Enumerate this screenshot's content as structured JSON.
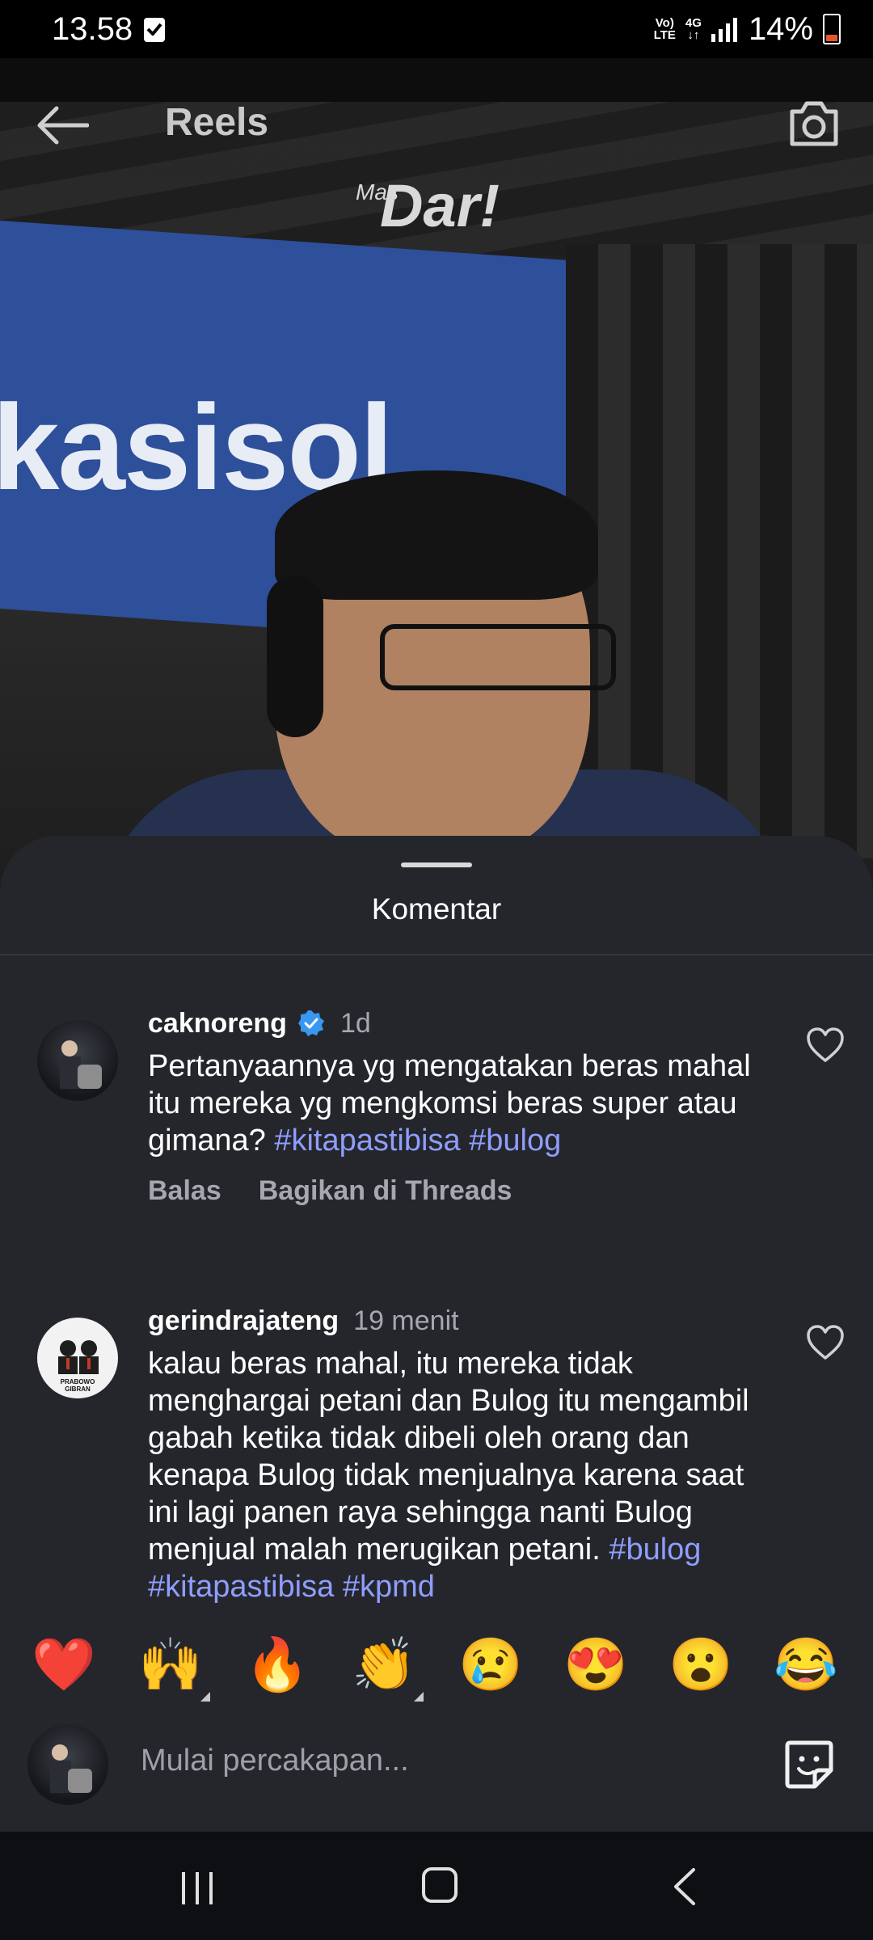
{
  "status_bar": {
    "time": "13.58",
    "network_top": "Vo)",
    "network_bottom": "LTE",
    "network_type": "4G",
    "battery": "14%"
  },
  "video": {
    "logo_small": "Mas",
    "logo_big": "Dar!",
    "panel_text": "kasisol"
  },
  "header": {
    "title": "Reels",
    "back_icon": "arrow-left-icon",
    "camera_icon": "camera-icon"
  },
  "comments_sheet": {
    "title": "Komentar",
    "comments": [
      {
        "username": "caknoreng",
        "verified": true,
        "time": "1d",
        "text": "Pertanyaannya yg mengatakan beras mahal itu mereka yg mengkomsi beras super atau gimana?",
        "tags": [
          "#kitapastibisa",
          "#bulog"
        ],
        "reply_label": "Balas",
        "share_label": "Bagikan di Threads"
      },
      {
        "username": "gerindrajateng",
        "verified": false,
        "time": "19 menit",
        "text": "kalau beras mahal, itu mereka tidak menghargai petani dan Bulog itu mengambil gabah ketika tidak dibeli oleh orang dan kenapa Bulog tidak menjualnya karena saat ini lagi panen raya sehingga nanti Bulog menjual malah merugikan petani.",
        "tags": [
          "#bulog",
          "#kitapastibisa",
          "#kpmd"
        ],
        "avatar_caption": "PRABOWO GIBRAN"
      }
    ]
  },
  "emoji_bar": [
    "❤️",
    "🙌",
    "🔥",
    "👏",
    "😢",
    "😍",
    "😮",
    "😂"
  ],
  "input": {
    "placeholder": "Mulai percakapan...",
    "sticker_icon": "sticker-icon"
  },
  "navbar": {
    "recent_icon": "recent-apps-icon",
    "home_icon": "home-icon",
    "back_icon": "back-icon"
  }
}
